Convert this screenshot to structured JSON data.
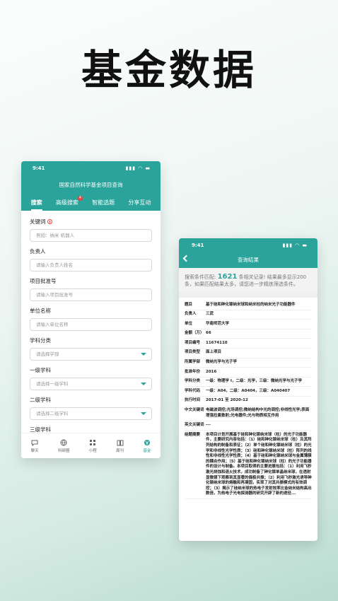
{
  "hero_title": "基金数据",
  "phone1": {
    "status_time": "9:41",
    "header_title": "国家自然科学基金项目查询",
    "tabs": [
      {
        "label": "搜索",
        "active": true
      },
      {
        "label": "高级搜索",
        "badge": "4"
      },
      {
        "label": "智能选题"
      },
      {
        "label": "分享互动"
      }
    ],
    "form": {
      "keyword_label": "关键词",
      "keyword_placeholder": "例如：纳米 机器人",
      "leader_label": "负责人",
      "leader_placeholder": "请输入负责人姓名",
      "approval_label": "项目批准号",
      "approval_placeholder": "请输入项目批准号",
      "unit_label": "单位名称",
      "unit_placeholder": "请输入单位名称",
      "dept_label": "学科分类",
      "dept_placeholder": "请选择学部",
      "lvl1_label": "一级学科",
      "lvl1_placeholder": "请选择一级学科",
      "lvl2_label": "二级学科",
      "lvl2_placeholder": "请选择二级学科",
      "lvl3_label": "三级学科"
    },
    "tabbar": [
      {
        "label": "聊天",
        "icon": "chat-icon"
      },
      {
        "label": "科研圈",
        "icon": "globe-icon"
      },
      {
        "label": "小程",
        "icon": "apps-icon"
      },
      {
        "label": "周刊",
        "icon": "book-icon"
      },
      {
        "label": "基金",
        "icon": "fund-icon",
        "active": true
      }
    ]
  },
  "phone2": {
    "status_time": "9:41",
    "header_title": "查询结果",
    "summary_prefix": "搜索条件匹配:",
    "summary_count": "1621",
    "summary_suffix": "条相关记录! 结果最多显示200条，如果匹配结果太多，请您进一步精炼筛选条件。",
    "rows": [
      {
        "k": "题目",
        "v": "基于硅和砷化镓纳米球和纳米柱的纳米光子功能器件"
      },
      {
        "k": "负责人",
        "v": "三武"
      },
      {
        "k": "单位",
        "v": "华南师范大学"
      },
      {
        "k": "金额（万）",
        "v": "66"
      },
      {
        "k": "项目编号",
        "v": "11674110"
      },
      {
        "k": "项目类型",
        "v": "面上项目"
      },
      {
        "k": "所属学部",
        "v": "微纳光学与光子学"
      },
      {
        "k": "批准年份",
        "v": "2016"
      },
      {
        "k": "学科分类",
        "v": "一级：物理学 I，二级：光学，三级：微纳光学与光子学"
      },
      {
        "k": "学科代码",
        "v": "一级：A04，二级：A0404，三级：A040407"
      },
      {
        "k": "执行时间",
        "v": "2017-01 至 2020-12"
      },
      {
        "k": "中文关键词",
        "v": "电磁波调控;光场调控;微纳结构中光的调控;非线性光学;表面增强拉曼散射;光电器件;光与物质相互作用"
      },
      {
        "k": "英文关键词",
        "v": "---"
      },
      {
        "k": "结题摘要",
        "v": "本项目计划开展基于硅和砷化镓纳米球（柱）的光子功能器件，主要研究内容包括：（1）硅和砷化镓纳米球（柱）及其阵列结构的制备和表征；（2）单个硅和砷化镓纳米球（柱）的光学和非线性光学性质；（3）硅和砷化镓纳米球（柱）阵列的线性和非线性光学性质；（4）基于硅和砷化镓纳米球与金属薄膜的耦合作用；（5）基于硅和砷化镓纳米球（柱）的光子功能器件的设计与制备。本项目取得的主要进展包括：（1）利用飞秒激光烧蚀和退火技术，成功制备了砷化镓单晶纳米球，在透射显微镜下观察到其显著的偶极共振；（2）利用飞秒激光诱导砷化镓纳米球的熔融和再凝固，实现了对其共振模式的有效调控；（3）揭示了硅纳米球的热电子发射效率比金纳米结构高出数倍，为热电子光电探测器的研究开辟了新的途径..."
      }
    ]
  }
}
